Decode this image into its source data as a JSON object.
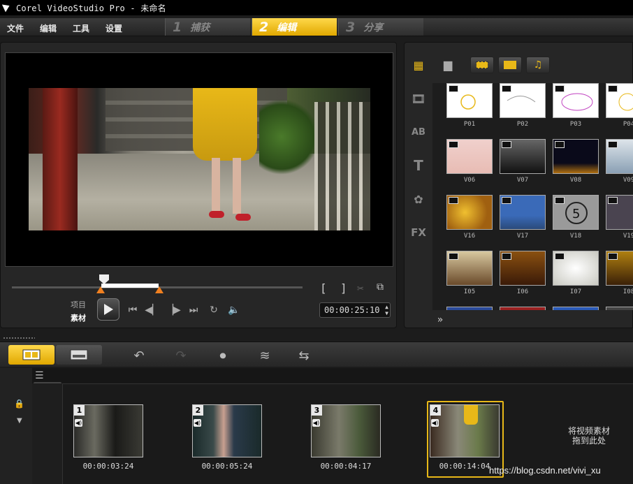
{
  "window": {
    "title": "Corel VideoStudio Pro - 未命名"
  },
  "menu": {
    "items": [
      "文件",
      "编辑",
      "工具",
      "设置"
    ]
  },
  "steps": [
    {
      "num": "1",
      "label": "捕获",
      "active": false
    },
    {
      "num": "2",
      "label": "编辑",
      "active": true
    },
    {
      "num": "3",
      "label": "分享",
      "active": false
    }
  ],
  "preview": {
    "mode_project": "项目",
    "mode_clip": "素材",
    "timecode": "00:00:25:10",
    "selection_start": 0.31,
    "selection_end": 0.51,
    "playhead": 0.31
  },
  "library": {
    "side_icons": [
      "media-icon",
      "transition-icon",
      "title-icon",
      "text-icon",
      "graphic-icon",
      "filter-icon"
    ],
    "top_icons": [
      "folder-icon",
      "video-filter-icon",
      "image-filter-icon",
      "audio-filter-icon"
    ],
    "thumbnails": [
      {
        "label": "P01"
      },
      {
        "label": "P02"
      },
      {
        "label": "P03"
      },
      {
        "label": "P04"
      },
      {
        "label": "V06"
      },
      {
        "label": "V07"
      },
      {
        "label": "V08"
      },
      {
        "label": "V09"
      },
      {
        "label": "V16"
      },
      {
        "label": "V17"
      },
      {
        "label": "V18"
      },
      {
        "label": "V19"
      },
      {
        "label": "I05"
      },
      {
        "label": "I06"
      },
      {
        "label": "I07"
      },
      {
        "label": "I08"
      }
    ]
  },
  "timeline": {
    "tools": [
      "undo-icon",
      "redo-icon",
      "record-capture-icon",
      "audio-mixer-icon",
      "auto-music-icon"
    ],
    "clips": [
      {
        "num": "1",
        "duration": "00:00:03:24"
      },
      {
        "num": "2",
        "duration": "00:00:05:24"
      },
      {
        "num": "3",
        "duration": "00:00:04:17"
      },
      {
        "num": "4",
        "duration": "00:00:14:04"
      }
    ],
    "drop_hint": "将视频素材拖到此处"
  },
  "watermark": "https://blog.csdn.net/vivi_xu",
  "colors": {
    "accent": "#e8b818",
    "marker": "#f08020"
  }
}
